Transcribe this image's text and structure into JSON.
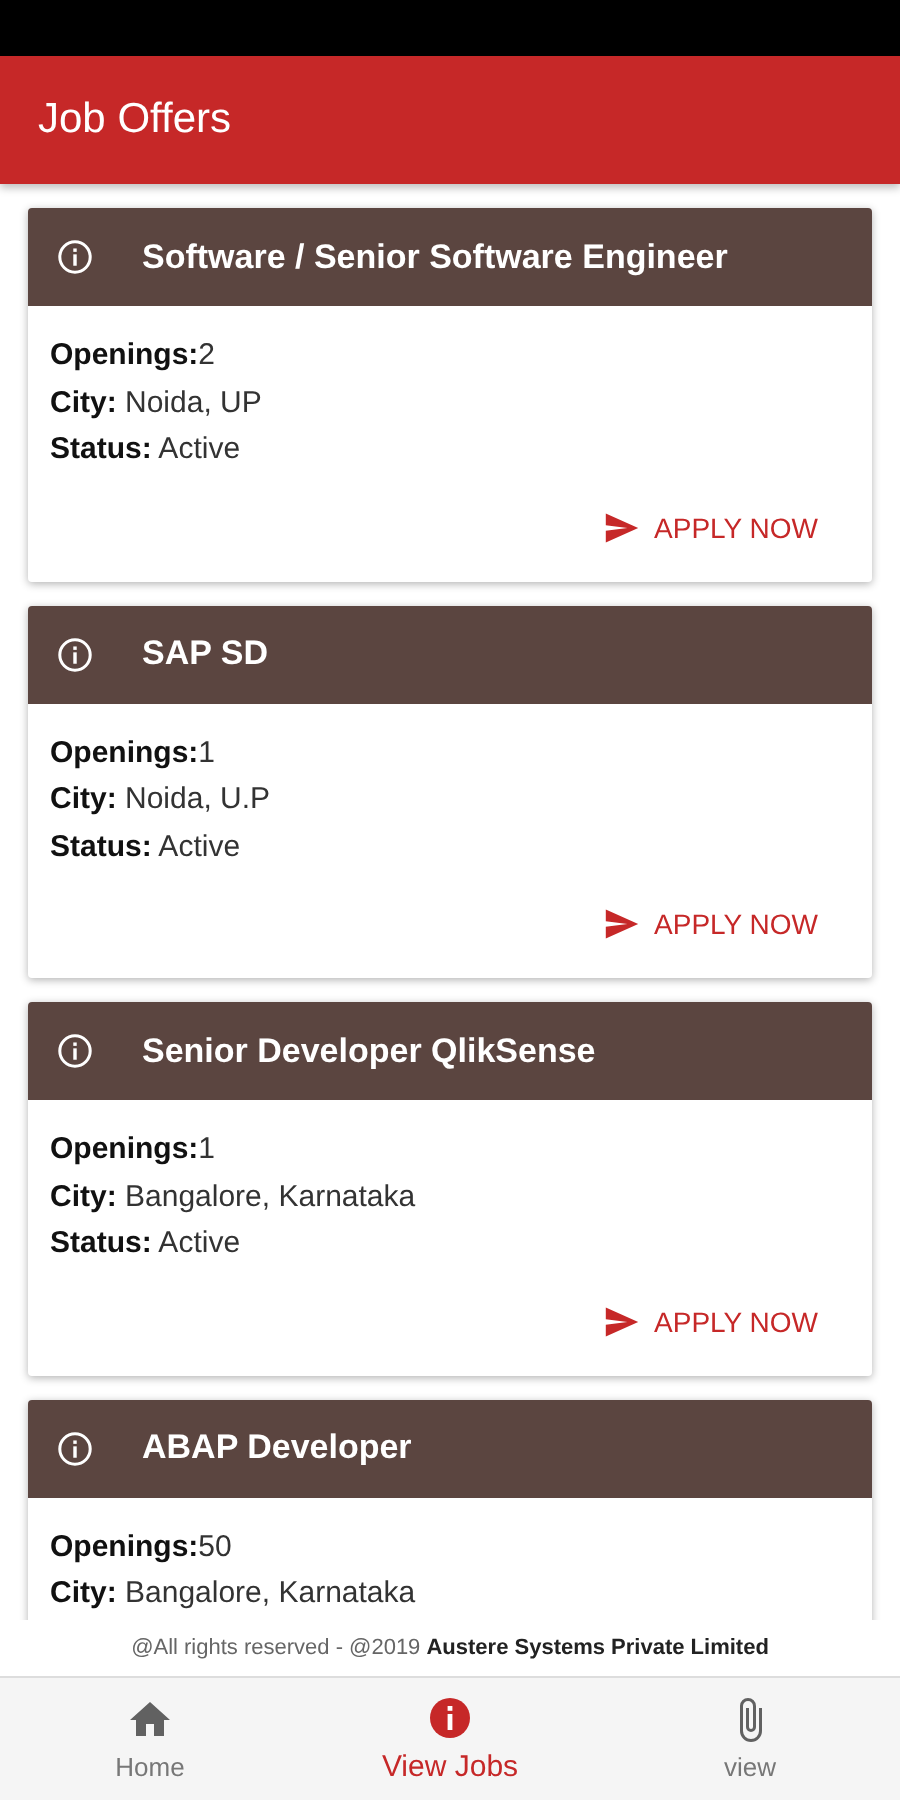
{
  "app_bar": {
    "title": "Job Offers"
  },
  "jobs": [
    {
      "title": "Software / Senior Software Engineer",
      "details": [
        "**Openings:**2",
        "**City:** Noida, UP",
        "**Status:** Active"
      ],
      "action": "APPLY NOW"
    },
    {
      "title": "SAP SD",
      "details": [
        "**Openings:**1",
        "**City:** Noida, U.P",
        "**Status:** Active"
      ],
      "action": "APPLY NOW"
    },
    {
      "title": "Senior Developer QlikSense",
      "details": [
        "**Openings:**1",
        "**City:** Bangalore, Karnataka",
        "**Status:** Active"
      ],
      "action": "APPLY NOW"
    },
    {
      "title": "ABAP Developer",
      "details": [
        "**Openings:**50",
        "**City:** Bangalore, Karnataka"
      ]
    }
  ],
  "footer": "@All rights reserved - @2019 **Austere Systems Private Limited**",
  "bottom_nav": [
    {
      "kind": "home",
      "label": "Home",
      "selected": false
    },
    {
      "kind": "info",
      "label": "View Jobs",
      "selected": true
    },
    {
      "kind": "attachment",
      "label": "view",
      "selected": false
    }
  ]
}
